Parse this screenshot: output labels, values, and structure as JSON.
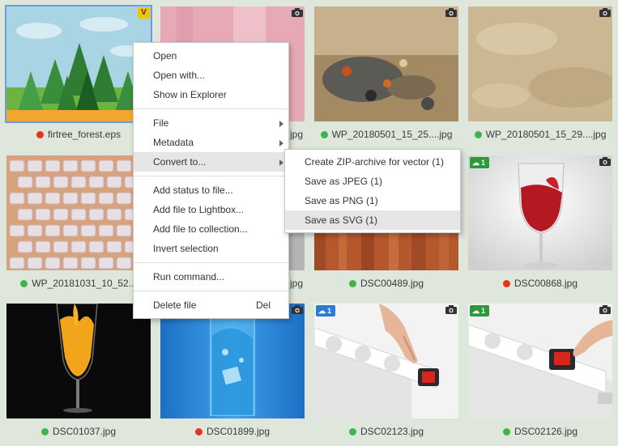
{
  "thumbnails": [
    {
      "filename": "firtree_forest.eps",
      "status": "red"
    },
    {
      "filename": "jpg",
      "status": "green"
    },
    {
      "filename": "WP_20180501_15_25....jpg",
      "status": "green"
    },
    {
      "filename": "WP_20180501_15_29....jpg",
      "status": "green"
    },
    {
      "filename": "WP_20181031_10_52...",
      "status": "green"
    },
    {
      "filename": "jpg",
      "status": "green"
    },
    {
      "filename": "DSC00489.jpg",
      "status": "green"
    },
    {
      "filename": "DSC00868.jpg",
      "status": "red"
    },
    {
      "filename": "DSC01037.jpg",
      "status": "green"
    },
    {
      "filename": "DSC01899.jpg",
      "status": "red"
    },
    {
      "filename": "DSC02123.jpg",
      "status": "green"
    },
    {
      "filename": "DSC02126.jpg",
      "status": "green"
    }
  ],
  "cloud_badges": {
    "b8": "1",
    "b10": "1",
    "b11": "1",
    "b12": "1"
  },
  "context_menu": {
    "open": "Open",
    "open_with": "Open with...",
    "show_in_explorer": "Show in Explorer",
    "file": "File",
    "metadata": "Metadata",
    "convert_to": "Convert to...",
    "add_status": "Add status to file...",
    "add_lightbox": "Add file to Lightbox...",
    "add_collection": "Add file to collection...",
    "invert_selection": "Invert selection",
    "run_command": "Run command...",
    "delete_file": "Delete file",
    "delete_shortcut": "Del"
  },
  "submenu": {
    "zip": "Create ZIP-archive for vector (1)",
    "jpeg": "Save as JPEG (1)",
    "png": "Save as PNG (1)",
    "svg": "Save as SVG (1)"
  },
  "colors": {
    "green": "#3db54a",
    "red": "#e8321c",
    "cloud_blue": "#2d7ad6",
    "cloud_green": "#2a9a3a",
    "selection": "#6a9fdc"
  }
}
